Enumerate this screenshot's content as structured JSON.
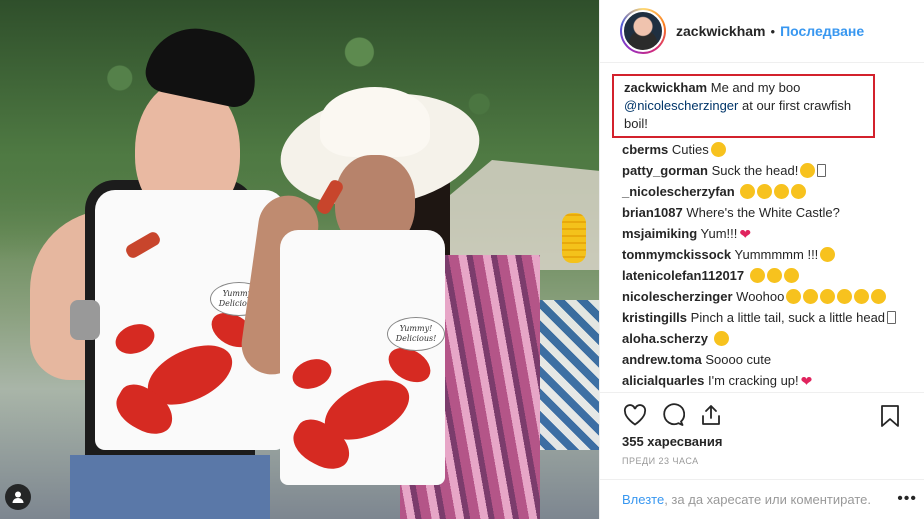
{
  "header": {
    "username": "zackwickham",
    "separator": "•",
    "follow_label": "Последване"
  },
  "photo": {
    "bib_text_line1": "Yummy!",
    "bib_text_line2": "Delicious!"
  },
  "caption": {
    "user": "zackwickham",
    "text_before": "Me and my boo",
    "mention": "@nicolescherzinger",
    "text_after": "at our first crawfish boil!"
  },
  "comments": [
    {
      "user": "cberms",
      "text": "Cuties",
      "emoji": [
        "face"
      ]
    },
    {
      "user": "patty_gorman",
      "text": "Suck the head!",
      "emoji": [
        "face",
        "tofu"
      ]
    },
    {
      "user": "_nicolescherzyfan",
      "text": "",
      "emoji": [
        "face",
        "face",
        "face",
        "face"
      ]
    },
    {
      "user": "brian1087",
      "text": "Where's the White Castle?",
      "emoji": []
    },
    {
      "user": "msjaimiking",
      "text": "Yum!!!",
      "emoji": [
        "heart"
      ]
    },
    {
      "user": "tommymckissock",
      "text": "Yummmmm !!!",
      "emoji": [
        "face"
      ]
    },
    {
      "user": "latenicolefan112017",
      "text": "",
      "emoji": [
        "face",
        "face",
        "face"
      ]
    },
    {
      "user": "nicolescherzinger",
      "text": "Woohoo",
      "emoji": [
        "face",
        "face",
        "face",
        "face",
        "face",
        "face"
      ]
    },
    {
      "user": "kristingills",
      "text": "Pinch a little tail, suck a little head",
      "emoji": [
        "tofu"
      ]
    },
    {
      "user": "aloha.scherzy",
      "text": "",
      "emoji": [
        "face"
      ]
    },
    {
      "user": "andrew.toma",
      "text": "Soooo cute",
      "emoji": []
    },
    {
      "user": "alicialquarles",
      "text": "I'm cracking up!",
      "emoji": [
        "heart"
      ]
    }
  ],
  "actions": {
    "likes": "355 харесвания",
    "time": "ПРЕДИ 23 ЧАСА"
  },
  "footer": {
    "login_link": "Влезте",
    "login_text": ", за да харесате или коментирате.",
    "more": "•••"
  },
  "colors": {
    "accent": "#3897f0",
    "highlight_box": "#d3212c",
    "heart": "#e0245e"
  }
}
